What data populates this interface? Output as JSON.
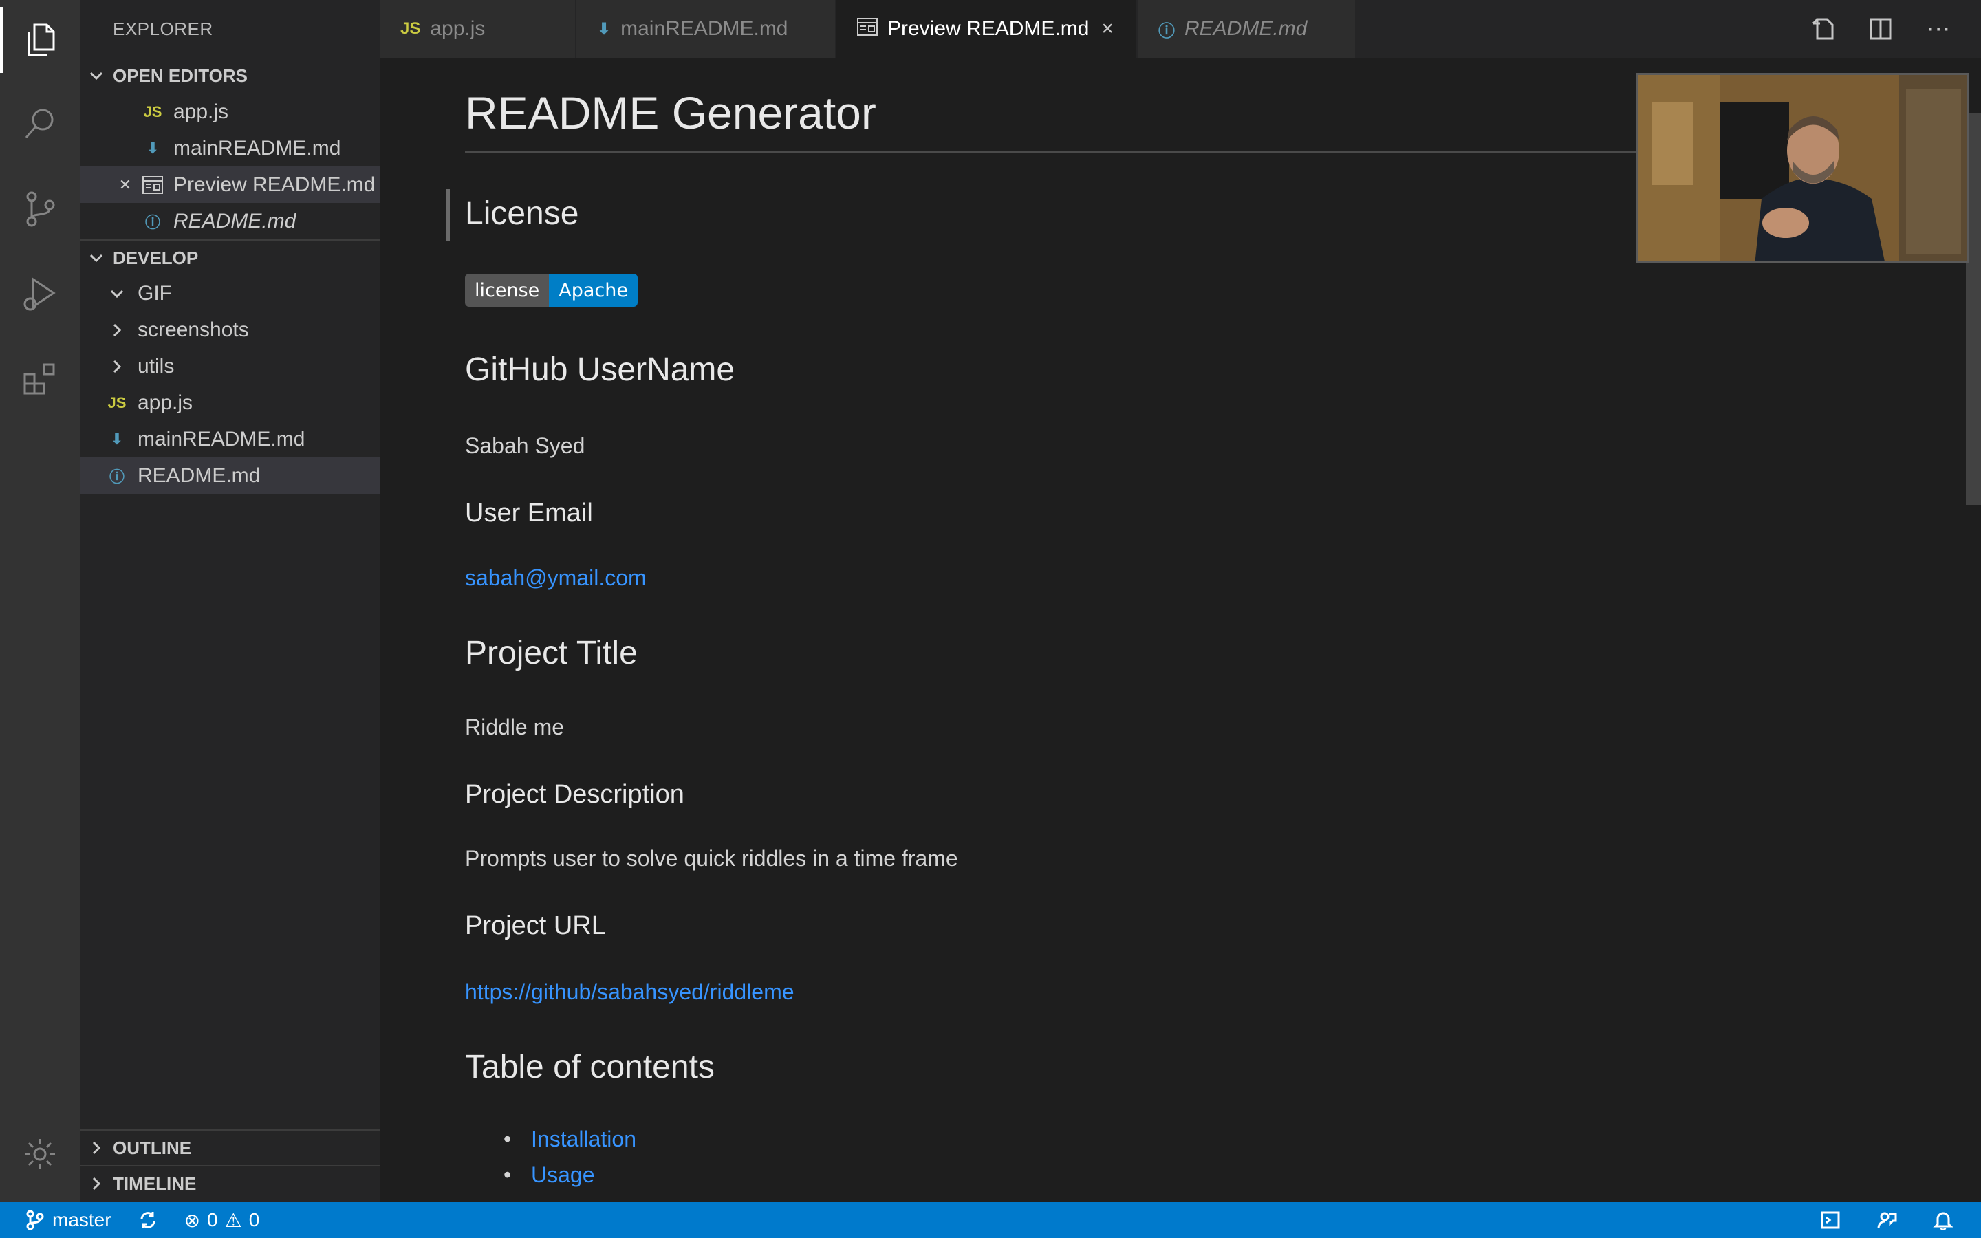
{
  "sidebar": {
    "title": "EXPLORER",
    "open_editors": {
      "label": "OPEN EDITORS",
      "items": [
        {
          "icon": "JS",
          "label": "app.js"
        },
        {
          "icon": "markdown-icon",
          "label": "mainREADME.md"
        },
        {
          "icon": "preview-icon",
          "label": "Preview README.md"
        },
        {
          "icon": "info-icon",
          "label": "README.md"
        }
      ]
    },
    "develop": {
      "label": "DEVELOP",
      "items": [
        {
          "label": "GIF"
        },
        {
          "label": "screenshots"
        },
        {
          "label": "utils"
        },
        {
          "icon": "JS",
          "label": "app.js"
        },
        {
          "icon": "markdown-icon",
          "label": "mainREADME.md"
        },
        {
          "icon": "info-icon",
          "label": "README.md"
        }
      ]
    },
    "outline_label": "OUTLINE",
    "timeline_label": "TIMELINE"
  },
  "tabs": [
    {
      "icon": "JS",
      "label": "app.js"
    },
    {
      "icon": "markdown-icon",
      "label": "mainREADME.md"
    },
    {
      "icon": "preview-icon",
      "label": "Preview README.md",
      "active": true
    },
    {
      "icon": "info-icon",
      "label": "README.md"
    }
  ],
  "tab_close": "×",
  "preview": {
    "title": "README Generator",
    "license_heading": "License",
    "badge_left": "license",
    "badge_right": "Apache",
    "github_heading": "GitHub UserName",
    "github_value": "Sabah Syed",
    "email_heading": "User Email",
    "email_value": "sabah@ymail.com",
    "project_title_heading": "Project Title",
    "project_title_value": "Riddle me",
    "description_heading": "Project Description",
    "description_value": "Prompts user to solve quick riddles in a time frame",
    "url_heading": "Project URL",
    "url_value": "https://github/sabahsyed/riddleme",
    "toc_heading": "Table of contents",
    "toc_items": [
      "Installation",
      "Usage"
    ]
  },
  "status": {
    "branch": "master",
    "errors": "0",
    "warnings": "0"
  },
  "colors": {
    "statusbar": "#007acc",
    "link": "#3794ff",
    "badge_right": "#007ec6"
  }
}
